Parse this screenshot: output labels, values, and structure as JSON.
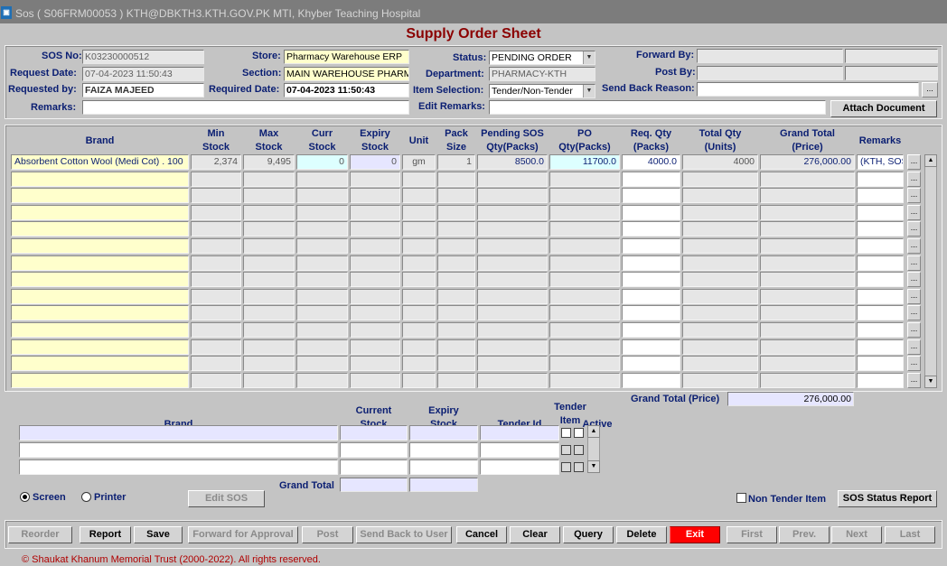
{
  "window": {
    "title": "Sos ( S06FRM00053 )  KTH@DBKTH3.KTH.GOV.PK   MTI, Khyber Teaching Hospital",
    "app_icon": "oracle-forms-icon"
  },
  "form_title": "Supply Order Sheet",
  "header": {
    "sos_no_label": "SOS No:",
    "sos_no": "K03230000512",
    "request_date_label": "Request Date:",
    "request_date": "07-04-2023 11:50:43",
    "requested_by_label": "Requested by:",
    "requested_by": "FAIZA MAJEED",
    "store_label": "Store:",
    "store": "Pharmacy Warehouse ERP",
    "section_label": "Section:",
    "section": "MAIN WAREHOUSE PHARMA",
    "required_date_label": "Required Date:",
    "required_date": "07-04-2023 11:50:43",
    "status_label": "Status:",
    "status": "PENDING ORDER",
    "department_label": "Department:",
    "department": "PHARMACY-KTH",
    "item_selection_label": "Item Selection:",
    "item_selection": "Tender/Non-Tender",
    "forward_by_label": "Forward By:",
    "post_by_label": "Post By:",
    "send_back_reason_label": "Send Back Reason:",
    "remarks_label": "Remarks:",
    "edit_remarks_label": "Edit Remarks:",
    "attach_document": "Attach Document",
    "ellipsis": "..."
  },
  "grid": {
    "columns": [
      "Brand",
      "Min\nStock",
      "Max\nStock",
      "Curr\nStock",
      "Expiry\nStock",
      "Unit",
      "Pack\nSize",
      "Pending SOS\nQty(Packs)",
      "PO\nQty(Packs)",
      "Req. Qty\n(Packs)",
      "Total Qty\n(Units)",
      "Grand Total\n(Price)",
      "Remarks"
    ],
    "rows": [
      [
        "Absorbent Cotton Wool (Medi Cot) . 100",
        "2,374",
        "9,495",
        "0",
        "0",
        "gm",
        "1",
        "8500.0",
        "11700.0",
        "4000.0",
        "4000",
        "276,000.00",
        "(KTH, SOS"
      ]
    ],
    "empty_rows": 13,
    "grand_total_label": "Grand Total (Price)",
    "grand_total": "276,000.00"
  },
  "lower": {
    "columns": [
      "Brand",
      "Current\nStock",
      "Expiry\nStock",
      "Tender Id",
      "Tender\nItem",
      "Active"
    ],
    "grand_total_label": "Grand Total"
  },
  "options": {
    "screen": "Screen",
    "printer": "Printer",
    "destination": "Screen",
    "edit_sos": "Edit SOS",
    "non_tender_item": "Non Tender Item",
    "non_tender_checked": false,
    "sos_status_report": "SOS Status Report"
  },
  "toolbar": [
    {
      "label": "Reorder",
      "enabled": false
    },
    {
      "label": "Report",
      "enabled": true
    },
    {
      "label": "Save",
      "enabled": true
    },
    {
      "label": "Forward for Approval",
      "enabled": false
    },
    {
      "label": "Post",
      "enabled": false
    },
    {
      "label": "Send Back to User",
      "enabled": false
    },
    {
      "label": "Cancel",
      "enabled": true
    },
    {
      "label": "Clear",
      "enabled": true
    },
    {
      "label": "Query",
      "enabled": true
    },
    {
      "label": "Delete",
      "enabled": true
    },
    {
      "label": "Exit",
      "enabled": true,
      "color": "#ff0000"
    },
    {
      "label": "First",
      "enabled": false
    },
    {
      "label": "Prev.",
      "enabled": false
    },
    {
      "label": "Next",
      "enabled": false
    },
    {
      "label": "Last",
      "enabled": false
    }
  ],
  "footer": "© Shaukat Khanum Memorial Trust (2000-2022). All rights reserved.",
  "colors": {
    "title": "#8b0000",
    "label": "#0a1e72",
    "exit": "#ff0000",
    "footer": "#b00000"
  }
}
